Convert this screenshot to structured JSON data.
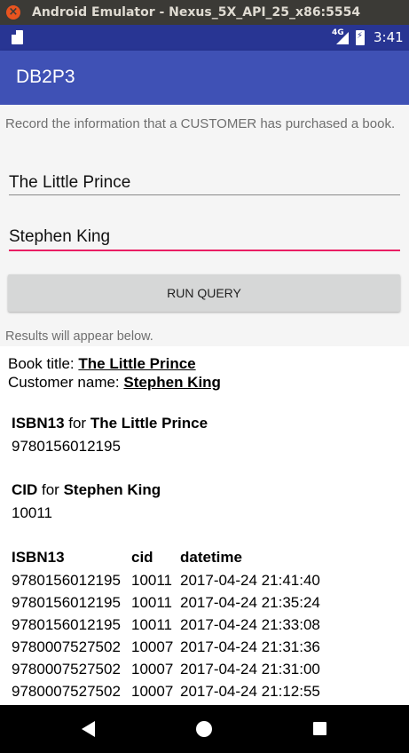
{
  "window": {
    "title": "Android Emulator - Nexus_5X_API_25_x86:5554",
    "close_icon": "×"
  },
  "statusbar": {
    "network": "4G",
    "time": "3:41"
  },
  "appbar": {
    "title": "DB2P3"
  },
  "form": {
    "instruction": "Record the information that a CUSTOMER has purchased a book.",
    "book_value": "The Little Prince",
    "customer_value": "Stephen King",
    "run_button": "RUN QUERY",
    "results_hint": "Results will appear below."
  },
  "result": {
    "book_title_label": "Book title: ",
    "book_title": "The Little Prince",
    "customer_name_label": "Customer name: ",
    "customer_name": "Stephen King",
    "isbn_key": "ISBN13",
    "isbn_for": " for ",
    "isbn_book": "The Little Prince",
    "isbn_value": "9780156012195",
    "cid_key": "CID",
    "cid_for": " for ",
    "cid_customer": "Stephen King",
    "cid_value": "10011",
    "table_headers": [
      "ISBN13",
      "cid",
      "datetime"
    ],
    "rows": [
      [
        "9780156012195",
        "10011",
        "2017-04-24 21:41:40"
      ],
      [
        "9780156012195",
        "10011",
        "2017-04-24 21:35:24"
      ],
      [
        "9780156012195",
        "10011",
        "2017-04-24 21:33:08"
      ],
      [
        "9780007527502",
        "10007",
        "2017-04-24 21:31:36"
      ],
      [
        "9780007527502",
        "10007",
        "2017-04-24 21:31:00"
      ],
      [
        "9780007527502",
        "10007",
        "2017-04-24 21:12:55"
      ]
    ]
  },
  "colors": {
    "primary": "#3f51b5",
    "primary_dark": "#283593",
    "accent": "#e91e63"
  },
  "icons": {
    "sd_card": "sd-card-icon",
    "signal": "signal-icon",
    "battery": "battery-charging-icon",
    "back": "back-icon",
    "home": "home-icon",
    "recent": "recent-apps-icon"
  }
}
